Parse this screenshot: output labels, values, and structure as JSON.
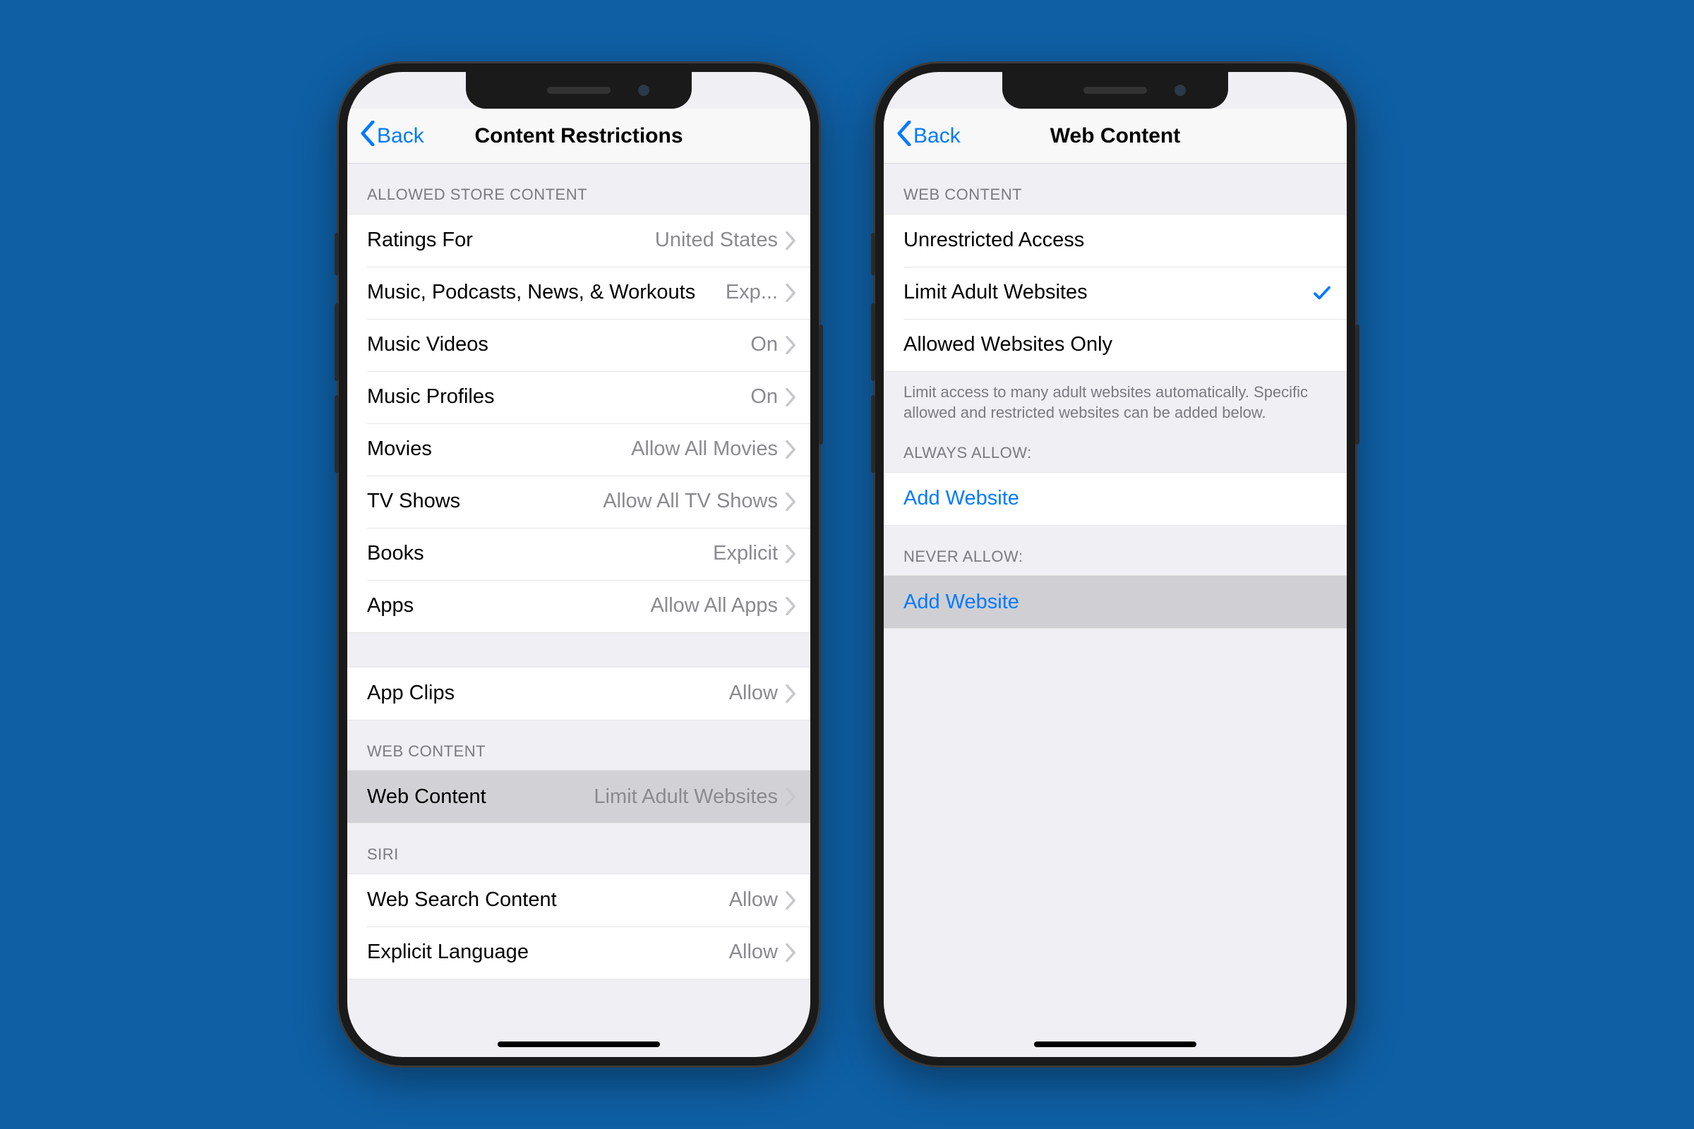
{
  "phone1": {
    "back_label": "Back",
    "title": "Content Restrictions",
    "sections": {
      "store_header": "ALLOWED STORE CONTENT",
      "store_rows": [
        {
          "label": "Ratings For",
          "value": "United States"
        },
        {
          "label": "Music, Podcasts, News, & Workouts",
          "value": "Exp..."
        },
        {
          "label": "Music Videos",
          "value": "On"
        },
        {
          "label": "Music Profiles",
          "value": "On"
        },
        {
          "label": "Movies",
          "value": "Allow All Movies"
        },
        {
          "label": "TV Shows",
          "value": "Allow All TV Shows"
        },
        {
          "label": "Books",
          "value": "Explicit"
        },
        {
          "label": "Apps",
          "value": "Allow All Apps"
        }
      ],
      "appclips_label": "App Clips",
      "appclips_value": "Allow",
      "web_header": "WEB CONTENT",
      "web_label": "Web Content",
      "web_value": "Limit Adult Websites",
      "siri_header": "SIRI",
      "siri_rows": [
        {
          "label": "Web Search Content",
          "value": "Allow"
        },
        {
          "label": "Explicit Language",
          "value": "Allow"
        }
      ]
    }
  },
  "phone2": {
    "back_label": "Back",
    "title": "Web Content",
    "header": "WEB CONTENT",
    "options": [
      {
        "label": "Unrestricted Access",
        "checked": false
      },
      {
        "label": "Limit Adult Websites",
        "checked": true
      },
      {
        "label": "Allowed Websites Only",
        "checked": false
      }
    ],
    "footer": "Limit access to many adult websites automatically. Specific allowed and restricted websites can be added below.",
    "always_header": "ALWAYS ALLOW:",
    "always_add": "Add Website",
    "never_header": "NEVER ALLOW:",
    "never_add": "Add Website"
  }
}
